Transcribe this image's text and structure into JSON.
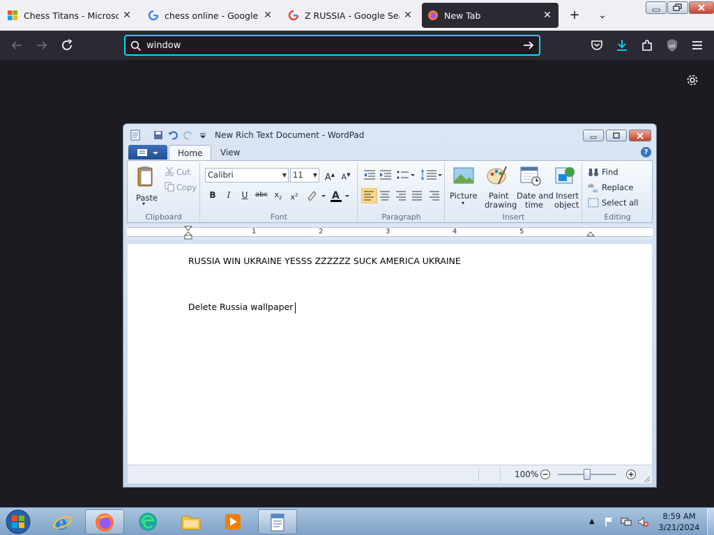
{
  "browser": {
    "tabs": [
      {
        "title": "Chess Titans - Microsoft Co",
        "favicon": "windows-logo-icon"
      },
      {
        "title": "chess online - Google Search",
        "favicon": "google-g-icon"
      },
      {
        "title": "Z RUSSIA - Google Search",
        "favicon": "google-g-icon"
      },
      {
        "title": "New Tab",
        "favicon": "firefox-icon",
        "active": true
      }
    ],
    "url_value": "window",
    "accent": "#00ddff"
  },
  "wordpad": {
    "title": "New Rich Text Document - WordPad",
    "tabs": [
      "Home",
      "View"
    ],
    "clipboard": {
      "paste": "Paste",
      "cut": "Cut",
      "copy": "Copy",
      "label": "Clipboard"
    },
    "font": {
      "family": "Calibri",
      "size": "11",
      "label": "Font"
    },
    "paragraph": {
      "label": "Paragraph"
    },
    "insert": {
      "picture": "Picture",
      "paint1": "Paint",
      "paint2": "drawing",
      "date1": "Date and",
      "date2": "time",
      "object1": "Insert",
      "object2": "object",
      "label": "Insert"
    },
    "editing": {
      "find": "Find",
      "replace": "Replace",
      "select_all": "Select all",
      "label": "Editing"
    },
    "ruler": [
      "1",
      "2",
      "3",
      "4",
      "5"
    ],
    "doc_lines": [
      "RUSSIA WIN UKRAINE YESSS ZZZZZZ SUCK AMERICA UKRAINE",
      "Delete Russia wallpaper"
    ],
    "zoom": "100%"
  },
  "taskbar": {
    "time": "8:59 AM",
    "date": "3/21/2024"
  }
}
